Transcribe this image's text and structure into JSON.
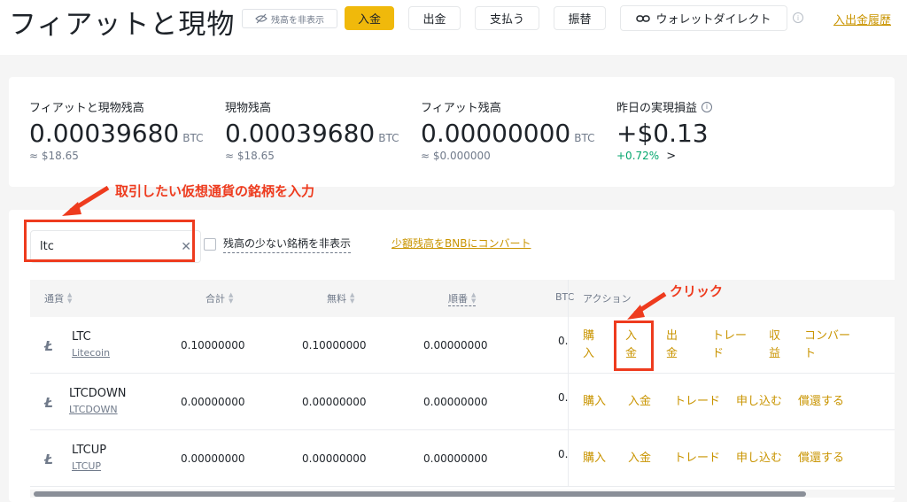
{
  "header": {
    "title": "フィアットと現物",
    "hide_balance": "残高を非表示",
    "buttons": {
      "deposit": "入金",
      "withdraw": "出金",
      "pay": "支払う",
      "transfer": "振替",
      "wallet_direct": "ウォレットダイレクト"
    },
    "history_link": "入出金履歴"
  },
  "balances": [
    {
      "label": "フィアットと現物残高",
      "value": "0.00039680",
      "unit": "BTC",
      "sub": "≈ $18.65"
    },
    {
      "label": "現物残高",
      "value": "0.00039680",
      "unit": "BTC",
      "sub": "≈ $18.65"
    },
    {
      "label": "フィアット残高",
      "value": "0.00000000",
      "unit": "BTC",
      "sub": "≈ $0.000000"
    },
    {
      "label": "昨日の実現損益",
      "value": "+$0.13",
      "unit": "",
      "sub": "+0.72%",
      "sub_arrow": ">"
    }
  ],
  "filters": {
    "search_value": "ltc",
    "hide_small_label": "残高の少ない銘柄を非表示",
    "convert_link": "少額残高をBNBにコンバート"
  },
  "table": {
    "columns": [
      "通貨",
      "合計",
      "無料",
      "順番",
      "BTC",
      "アクション"
    ],
    "rows": [
      {
        "symbol": "LTC",
        "name": "Litecoin",
        "total": "0.10000000",
        "free": "0.10000000",
        "order": "0.00000000",
        "btc": "0.",
        "actions": [
          "購入",
          "入金",
          "出金",
          "トレード",
          "収益",
          "コンバート"
        ]
      },
      {
        "symbol": "LTCDOWN",
        "name": "LTCDOWN",
        "total": "0.00000000",
        "free": "0.00000000",
        "order": "0.00000000",
        "btc": "0.",
        "actions": [
          "購入",
          "入金",
          "トレード",
          "申し込む",
          "償還する"
        ]
      },
      {
        "symbol": "LTCUP",
        "name": "LTCUP",
        "total": "0.00000000",
        "free": "0.00000000",
        "order": "0.00000000",
        "btc": "0.",
        "actions": [
          "購入",
          "入金",
          "トレード",
          "申し込む",
          "償還する"
        ]
      }
    ]
  },
  "annotations": {
    "search_hint": "取引したい仮想通貨の銘柄を入力",
    "click_hint": "クリック",
    "color": "#ee3b1e"
  },
  "colors": {
    "accent": "#f0b90b",
    "link": "#c99400",
    "positive": "#03a66d"
  }
}
